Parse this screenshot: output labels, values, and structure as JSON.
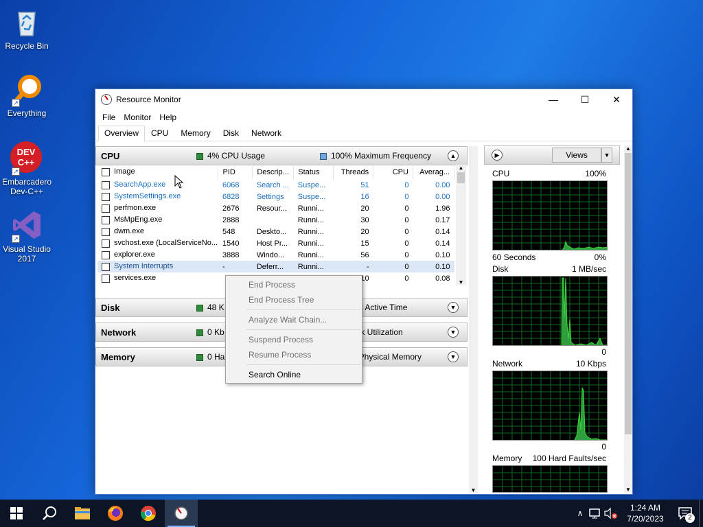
{
  "desktop": {
    "icons": [
      {
        "label_line1": "Recycle Bin",
        "label_line2": ""
      },
      {
        "label_line1": "Everything",
        "label_line2": ""
      },
      {
        "label_line1": "Embarcadero",
        "label_line2": "Dev-C++"
      },
      {
        "label_line1": "Visual Studio",
        "label_line2": "2017"
      }
    ],
    "devcpp_badge": "DEV C++"
  },
  "window": {
    "title": "Resource Monitor",
    "minimize": "—",
    "maximize": "☐",
    "close": "✕"
  },
  "menu": [
    "File",
    "Monitor",
    "Help"
  ],
  "tabs": [
    "Overview",
    "CPU",
    "Memory",
    "Disk",
    "Network"
  ],
  "cpu_section": {
    "name": "CPU",
    "usage": "4% CPU Usage",
    "frequency": "100% Maximum Frequency",
    "columns": [
      "Image",
      "PID",
      "Descrip...",
      "Status",
      "Threads",
      "CPU",
      "Averag..."
    ],
    "rows": [
      {
        "image": "SearchApp.exe",
        "pid": "6068",
        "desc": "Search ...",
        "status": "Suspe...",
        "threads": "51",
        "cpu": "0",
        "avg": "0.00"
      },
      {
        "image": "SystemSettings.exe",
        "pid": "6828",
        "desc": "Settings",
        "status": "Suspe...",
        "threads": "16",
        "cpu": "0",
        "avg": "0.00"
      },
      {
        "image": "perfmon.exe",
        "pid": "2676",
        "desc": "Resour...",
        "status": "Runni...",
        "threads": "20",
        "cpu": "0",
        "avg": "1.96"
      },
      {
        "image": "MsMpEng.exe",
        "pid": "2888",
        "desc": "",
        "status": "Runni...",
        "threads": "30",
        "cpu": "0",
        "avg": "0.17"
      },
      {
        "image": "dwm.exe",
        "pid": "548",
        "desc": "Deskto...",
        "status": "Runni...",
        "threads": "20",
        "cpu": "0",
        "avg": "0.14"
      },
      {
        "image": "svchost.exe (LocalServiceNo...",
        "pid": "1540",
        "desc": "Host Pr...",
        "status": "Runni...",
        "threads": "15",
        "cpu": "0",
        "avg": "0.14"
      },
      {
        "image": "explorer.exe",
        "pid": "3888",
        "desc": "Windo...",
        "status": "Runni...",
        "threads": "56",
        "cpu": "0",
        "avg": "0.10"
      },
      {
        "image": "System Interrupts",
        "pid": "-",
        "desc": "Deferr...",
        "status": "Runni...",
        "threads": "-",
        "cpu": "0",
        "avg": "0.10"
      },
      {
        "image": "services.exe",
        "pid": "",
        "desc": "",
        "status": "",
        "threads": "10",
        "cpu": "0",
        "avg": "0.08"
      }
    ]
  },
  "disk_section": {
    "name": "Disk",
    "left": "48 K",
    "right": "hest Active Time"
  },
  "network_section": {
    "name": "Network",
    "left": "0 Kb",
    "right": "work Utilization"
  },
  "memory_section": {
    "name": "Memory",
    "left": "0 Ha",
    "right": "ed Physical Memory"
  },
  "context_menu": {
    "items": [
      "End Process",
      "End Process Tree",
      "Analyze Wait Chain...",
      "Suspend Process",
      "Resume Process",
      "Search Online"
    ]
  },
  "right_pane": {
    "views_label": "Views",
    "graphs": [
      {
        "name": "CPU",
        "max": "100%",
        "foot_left": "60 Seconds",
        "foot_right": "0%"
      },
      {
        "name": "Disk",
        "max": "1 MB/sec",
        "foot_left": "",
        "foot_right": "0"
      },
      {
        "name": "Network",
        "max": "10 Kbps",
        "foot_left": "",
        "foot_right": "0"
      },
      {
        "name": "Memory",
        "max": "100 Hard Faults/sec",
        "foot_left": "",
        "foot_right": ""
      }
    ]
  },
  "taskbar": {
    "time": "1:24 AM",
    "date": "7/20/2023",
    "notification_count": "2"
  },
  "colors": {
    "graph_line": "#39d839",
    "grid": "#0f6a24",
    "suspended_text": "#1a6fc1"
  }
}
